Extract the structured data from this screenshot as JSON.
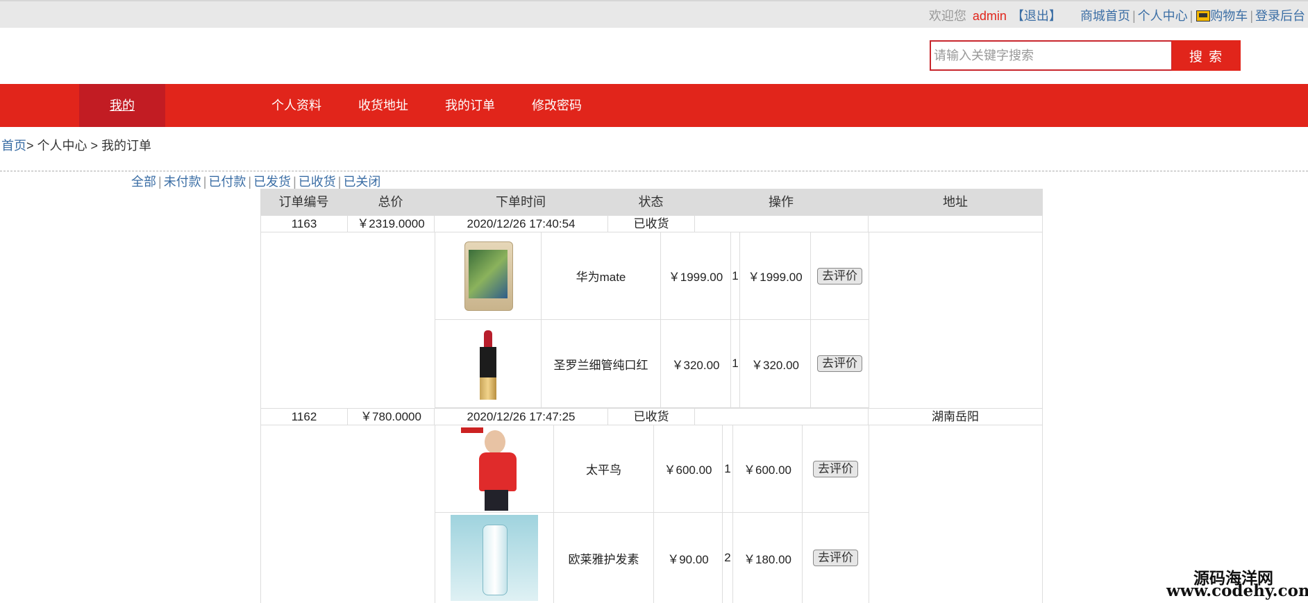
{
  "topbar": {
    "welcome": "欢迎您",
    "username": "admin",
    "logout": "【退出】",
    "home": "商城首页",
    "center": "个人中心",
    "cart": "购物车",
    "admin": "登录后台",
    "sep": "|"
  },
  "search": {
    "placeholder": "请输入关键字搜索",
    "button": "搜 索"
  },
  "nav": {
    "mine": "我的",
    "items": [
      "个人资料",
      "收货地址",
      "我的订单",
      "修改密码"
    ]
  },
  "breadcrumb": {
    "home": "首页",
    "rest": "> 个人中心 > 我的订单"
  },
  "filters": [
    "全部",
    "未付款",
    "已付款",
    "已发货",
    "已收货",
    "已关闭"
  ],
  "table": {
    "headers": [
      "订单编号",
      "总价",
      "下单时间",
      "状态",
      "操作",
      "地址"
    ],
    "orders": [
      {
        "id": "1163",
        "total": "￥2319.0000",
        "time": "2020/12/26 17:40:54",
        "status": "已收货",
        "address": "",
        "items": [
          {
            "name": "华为mate",
            "price": "￥1999.00",
            "qty": "1",
            "subtotal": "￥1999.00",
            "action": "去评价",
            "image": "phone"
          },
          {
            "name": "圣罗兰细管纯口红",
            "price": "￥320.00",
            "qty": "1",
            "subtotal": "￥320.00",
            "action": "去评价",
            "image": "lipstick"
          }
        ]
      },
      {
        "id": "1162",
        "total": "￥780.0000",
        "time": "2020/12/26 17:47:25",
        "status": "已收货",
        "address": "湖南岳阳",
        "items": [
          {
            "name": "太平鸟",
            "price": "￥600.00",
            "qty": "1",
            "subtotal": "￥600.00",
            "action": "去评价",
            "image": "kids-clothing"
          },
          {
            "name": "欧莱雅护发素",
            "price": "￥90.00",
            "qty": "2",
            "subtotal": "￥180.00",
            "action": "去评价",
            "image": "hair-conditioner"
          }
        ]
      }
    ]
  },
  "watermark": {
    "line1": "源码海洋网",
    "line2": "www.codehy.com"
  }
}
